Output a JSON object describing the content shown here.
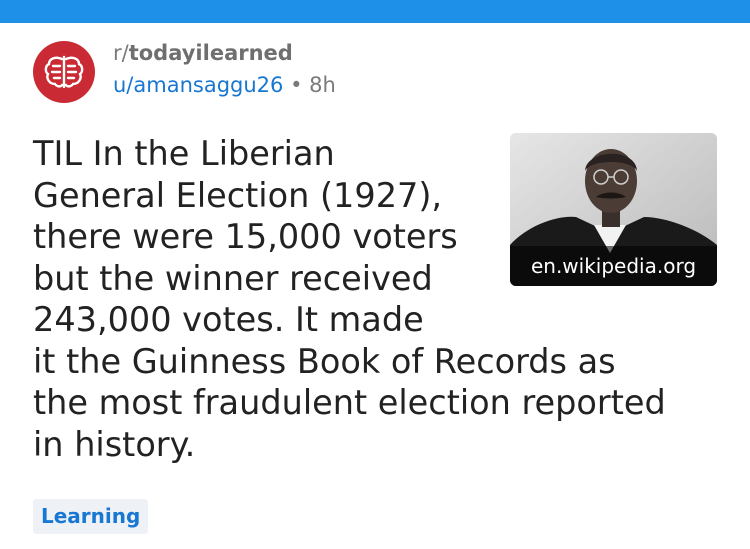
{
  "header": {
    "color": "#1e90e8"
  },
  "post": {
    "subreddit_prefix": "r/",
    "subreddit": "todayilearned",
    "author": "u/amansaggu26",
    "separator": "•",
    "age": "8h",
    "title_lines": [
      "TIL In the Liberian",
      "General Election (1927),",
      "there were 15,000 voters",
      "but the winner received",
      "243,000 votes. It made",
      "it the Guinness Book of Records as",
      "the most fraudulent election reported",
      "in history."
    ],
    "thumbnail": {
      "domain": "en.wikipedia.org"
    },
    "flair": "Learning"
  },
  "colors": {
    "avatar": "#c92a33",
    "link": "#1877d3",
    "flair_bg": "#eef2f7"
  },
  "icons": {
    "subreddit_avatar": "brain-icon"
  }
}
